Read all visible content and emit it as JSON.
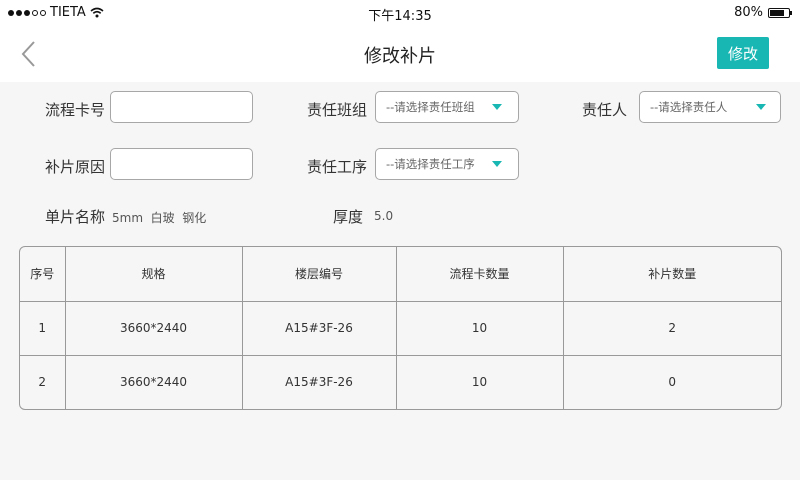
{
  "status_bar": {
    "carrier": "TIETA",
    "time": "下午14:35",
    "battery": "80%",
    "battery_level": 0.8
  },
  "nav": {
    "title": "修改补片",
    "edit_label": "修改"
  },
  "form": {
    "flow_card_label": "流程卡号",
    "flow_card_value": "",
    "patch_reason_label": "补片原因",
    "patch_reason_value": "",
    "team_label": "责任班组",
    "team_placeholder": "--请选择责任班组",
    "process_label": "责任工序",
    "process_placeholder": "--请选择责任工序",
    "person_label": "责任人",
    "person_placeholder": "--请选择责任人",
    "piece_name_label": "单片名称",
    "piece_name_value": "5mm  白玻  钢化",
    "thickness_label": "厚度",
    "thickness_value": "5.0"
  },
  "table": {
    "headers": [
      "序号",
      "规格",
      "楼层编号",
      "流程卡数量",
      "补片数量"
    ],
    "rows": [
      [
        "1",
        "3660*2440",
        "A15#3F-26",
        "10",
        "2"
      ],
      [
        "2",
        "3660*2440",
        "A15#3F-26",
        "10",
        "0"
      ]
    ]
  }
}
